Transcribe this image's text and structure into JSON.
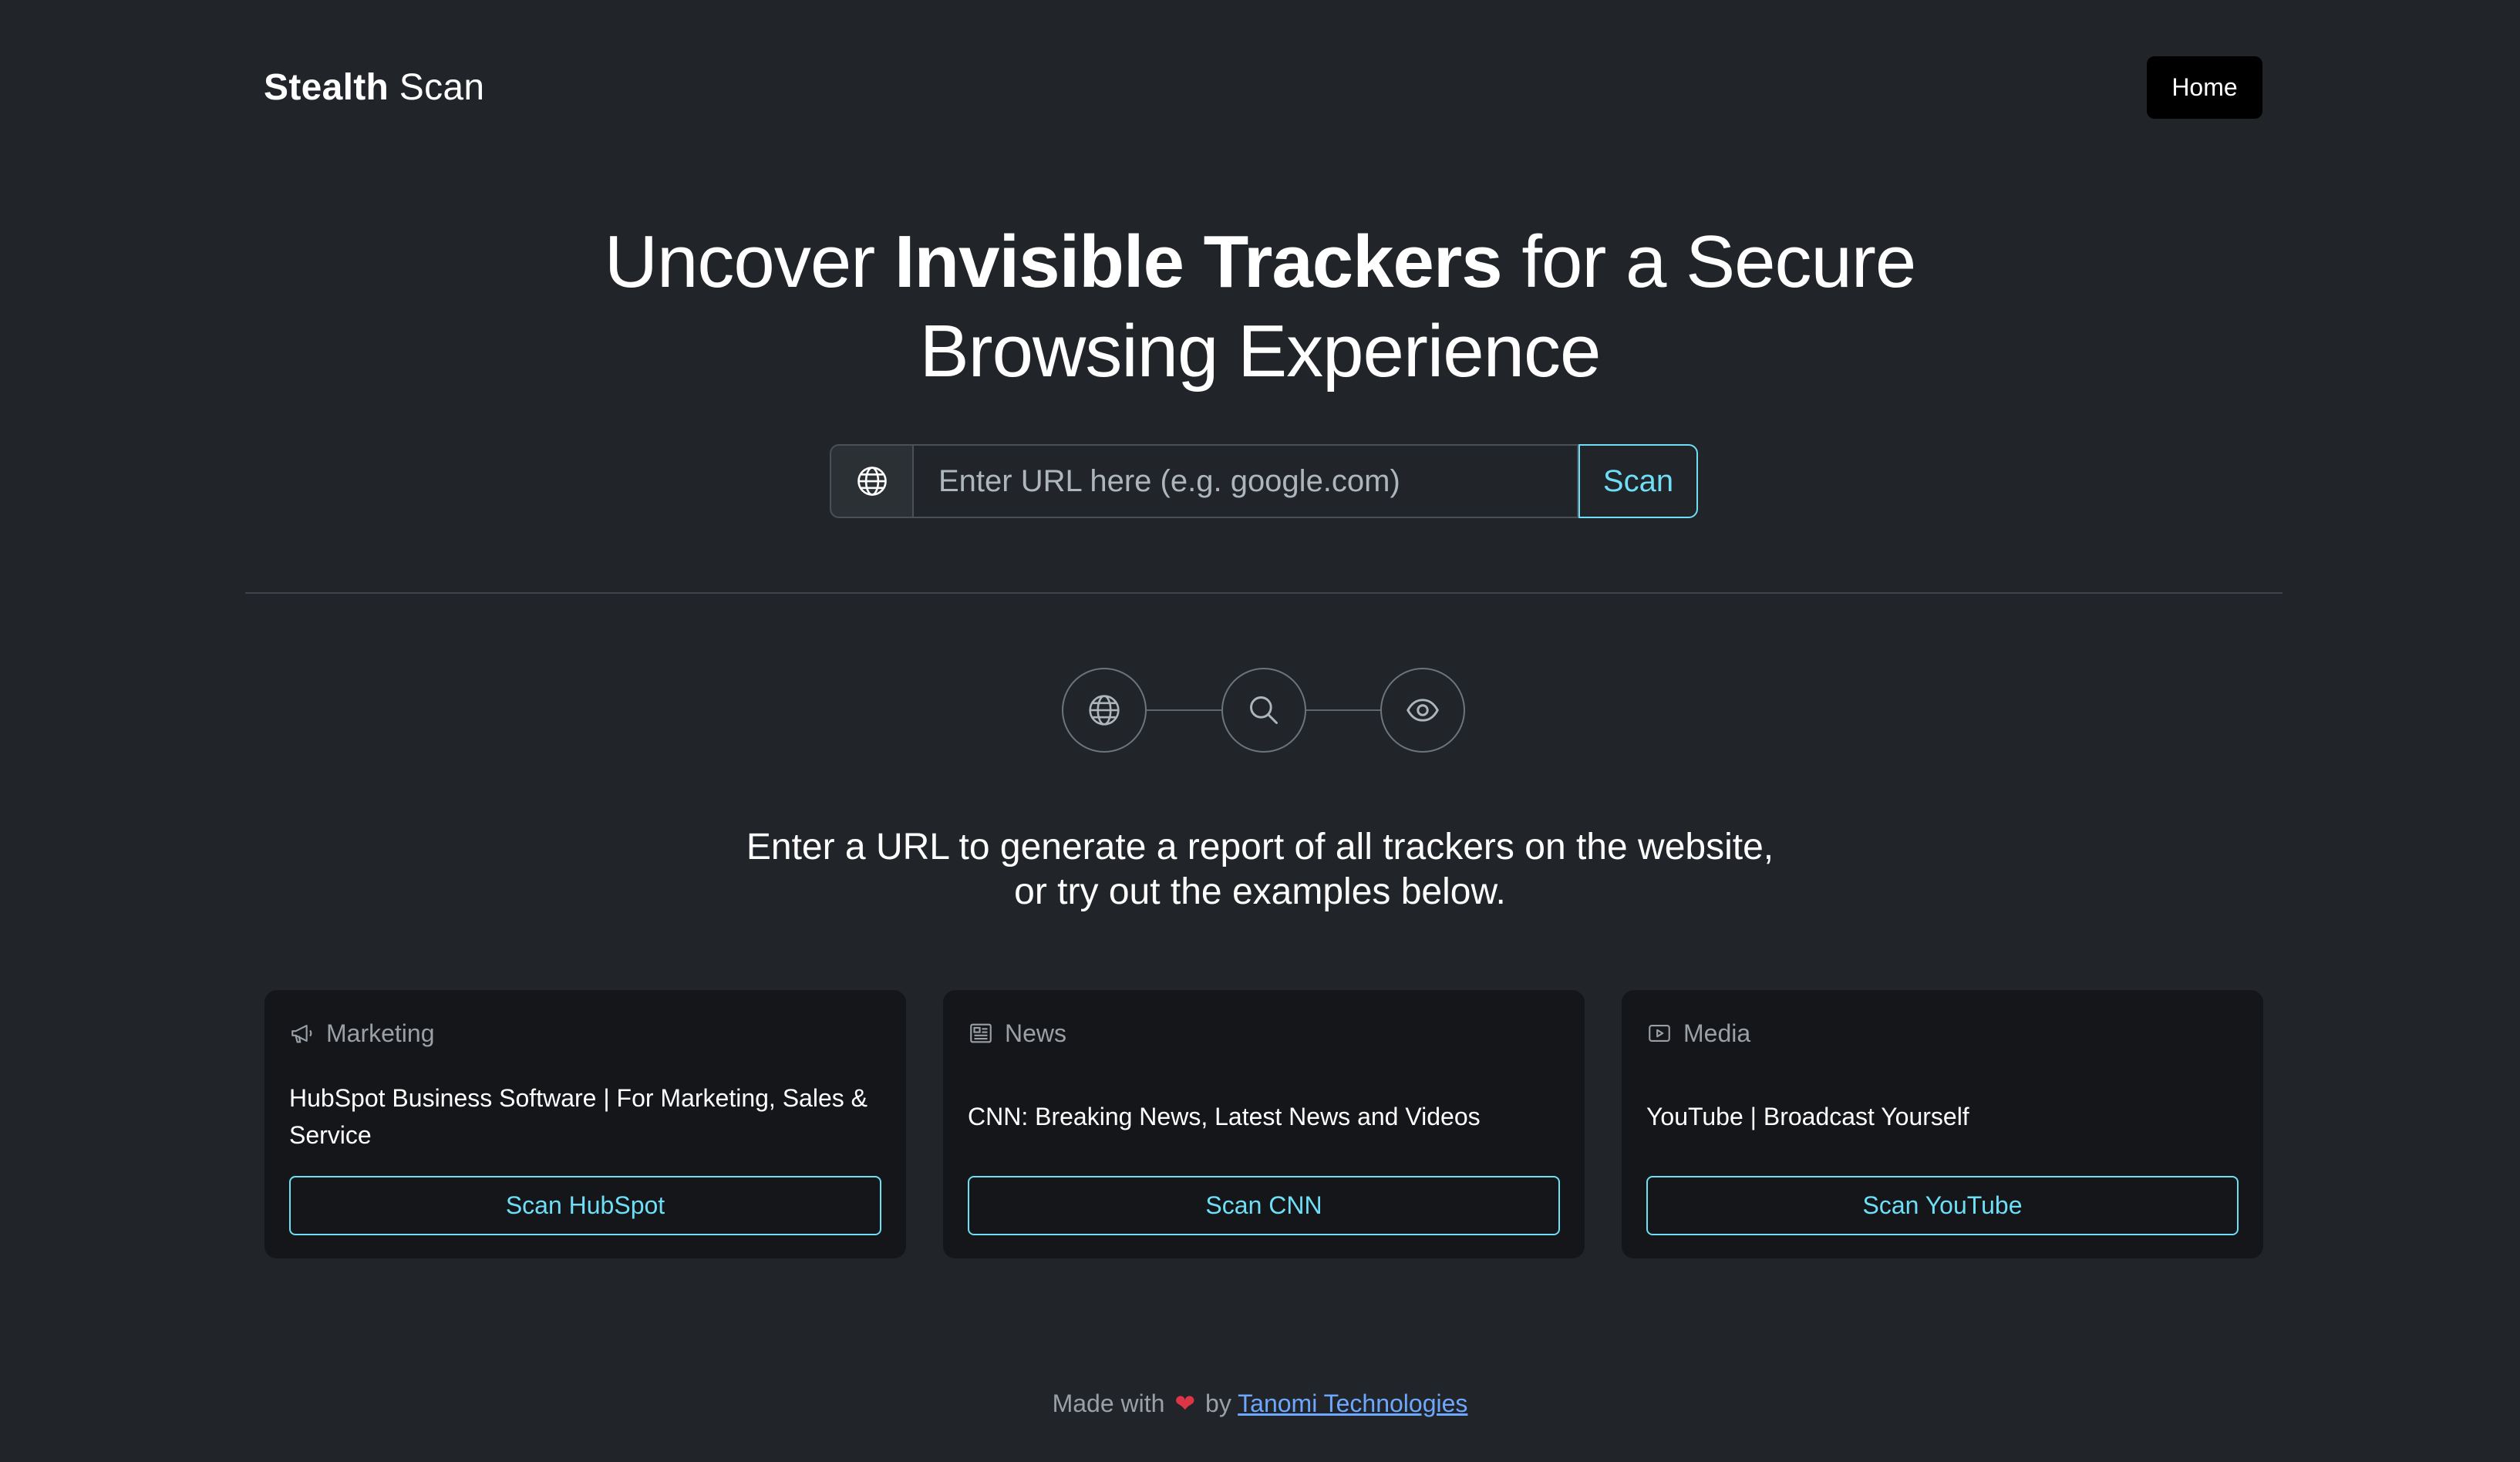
{
  "header": {
    "brand_bold": "Stealth",
    "brand_light": "Scan",
    "home_label": "Home"
  },
  "hero": {
    "line1_pre": "Uncover ",
    "line1_bold": "Invisible Trackers",
    "line1_post": " for a Secure",
    "line2": "Browsing Experience"
  },
  "search": {
    "placeholder": "Enter URL here (e.g. google.com)",
    "scan_label": "Scan",
    "icon": "globe-icon"
  },
  "steps": {
    "icons": [
      "globe-icon",
      "search-icon",
      "eye-icon"
    ]
  },
  "lead": {
    "line1": "Enter a URL to generate a report of all trackers on the website,",
    "line2": "or try out the examples below."
  },
  "cards": [
    {
      "category": "Marketing",
      "icon": "megaphone-icon",
      "title": "HubSpot Business Software | For Marketing, Sales & Service",
      "button": "Scan HubSpot"
    },
    {
      "category": "News",
      "icon": "newspaper-icon",
      "title": "CNN: Breaking News, Latest News and Videos",
      "button": "Scan CNN"
    },
    {
      "category": "Media",
      "icon": "play-icon",
      "title": "YouTube | Broadcast Yourself",
      "button": "Scan YouTube"
    }
  ],
  "footer": {
    "made_with": "Made with",
    "heart": "❤",
    "by": "by",
    "link_text": "Tanomi Technologies"
  },
  "colors": {
    "background": "#212529",
    "card_background": "#141619",
    "accent_cyan": "#6edff6",
    "link_blue": "#6ea8fe",
    "heart_red": "#dc3545"
  }
}
